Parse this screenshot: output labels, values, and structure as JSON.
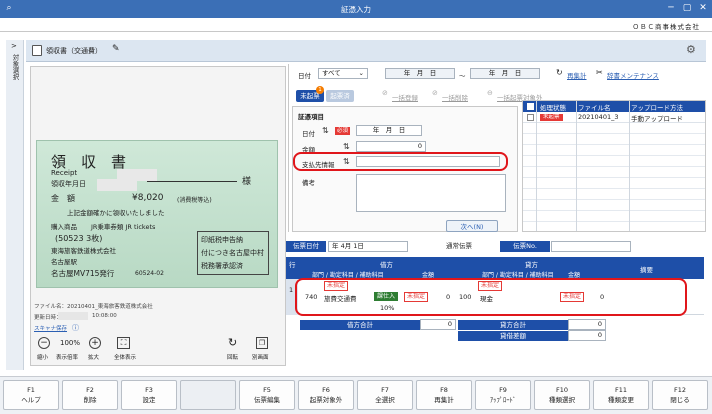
{
  "window": {
    "title": "証憑入力",
    "company": "ＯＢＣ商事株式会社"
  },
  "sidetab": {
    "label": "対象選択"
  },
  "header": {
    "doc_type": "領収書（交通費）"
  },
  "filter": {
    "date_label": "日付",
    "date_select": "すべて",
    "date_from": "年　月　日",
    "range_sep": "～",
    "date_to": "年　月　日",
    "refresh": "再集計",
    "dict": "辞書メンテナンス"
  },
  "tabs": {
    "unposted": "未起票",
    "posted": "起票済",
    "badge": "1",
    "bulk_register": "一括登録",
    "bulk_delete": "一括削除",
    "bulk_exclude": "一括起票対象外"
  },
  "form": {
    "section": "証憑項目",
    "date_label": "日付",
    "required": "必須",
    "date_value": "年　月　日",
    "amount_label": "金額",
    "amount_value": "0",
    "payee_label": "支払先情報",
    "payee_value": "",
    "memo_label": "備考",
    "next_button": "次へ(N)"
  },
  "doclist": {
    "headers": [
      "処理状態",
      "ファイル名",
      "アップロード方法"
    ],
    "rows": [
      {
        "status": "未起票",
        "file": "20210401_3",
        "method": "手動アップロード"
      }
    ]
  },
  "image": {
    "filename": "ファイル名：20210401_東海旅客鉄道株式会社",
    "updated": "更新日時：",
    "time": "10:08:00",
    "scanner": "スキャナ保存",
    "zoom": "100%",
    "tools": [
      "縮小",
      "表示倍率",
      "拡大",
      "全体表示",
      "回転",
      "別画面"
    ],
    "receipt": {
      "title": "領　収　書",
      "sama": "様",
      "receipt_en": "Receipt",
      "date": "領収年月日",
      "amount_label": "金　額",
      "amount": "¥8,020",
      "tax": "(消費税等込)",
      "line1": "上記金額確かに領収いたしました",
      "item_label": "購入商品",
      "item": "JR乗車券類 JR tickets",
      "code": "(50523 3枚)",
      "issuer": "東海旅客鉄道株式会社",
      "station": "名古屋駅",
      "machine": "名古屋MV715発行",
      "serial": "60524-02",
      "stamp1": "印紙税申告納",
      "stamp2": "付につき名古屋中村",
      "stamp3": "税務署承認済"
    }
  },
  "slip": {
    "date_label": "伝票日付",
    "date_value": "年 4月 1日",
    "type": "通常伝票",
    "no_label": "伝票No.",
    "row_header": "行",
    "debit": "借方",
    "credit": "貸方",
    "summary": "摘要",
    "sub_headers": [
      "部門 / 勘定科目 / 補助科目",
      "金額",
      "部門 / 勘定科目 / 補助科目",
      "金額"
    ],
    "line": {
      "no": "1",
      "d_dept": "未指定",
      "d_code": "740",
      "d_account": "旅費交通費",
      "d_sub": "未指定",
      "d_tax": "課仕入",
      "d_rate": "10%",
      "d_amount": "0",
      "c_dept": "未指定",
      "c_code": "100",
      "c_account": "現金",
      "c_sub": "未指定",
      "c_amount": "0"
    },
    "debit_total_label": "借方合計",
    "debit_total": "0",
    "credit_total_label": "貸方合計",
    "credit_total": "0",
    "diff_label": "貸借差額",
    "diff": "0"
  },
  "fkeys": [
    {
      "key": "F1",
      "label": "ヘルプ"
    },
    {
      "key": "F2",
      "label": "削除"
    },
    {
      "key": "F3",
      "label": "設定"
    },
    {
      "key": "",
      "label": ""
    },
    {
      "key": "F5",
      "label": "伝票編集"
    },
    {
      "key": "F6",
      "label": "起票対象外"
    },
    {
      "key": "F7",
      "label": "全選択"
    },
    {
      "key": "F8",
      "label": "再集計"
    },
    {
      "key": "F9",
      "label": "ｱｯﾌﾟﾛｰﾄﾞ"
    },
    {
      "key": "F10",
      "label": "種類選択"
    },
    {
      "key": "F11",
      "label": "種類変更"
    },
    {
      "key": "F12",
      "label": "閉じる"
    }
  ],
  "colors": {
    "titlebar": "#3b6fb6",
    "accent_red": "#e0161b",
    "tab_active": "#1e4fa8"
  }
}
